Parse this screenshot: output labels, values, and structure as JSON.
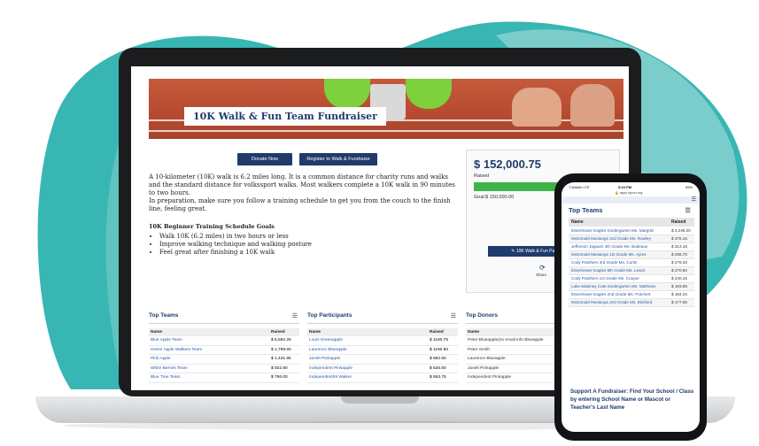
{
  "colors": {
    "teal": "#38b6b4",
    "teal_light": "#a6dcd8",
    "navy": "#1f3b6b",
    "green": "#3eb34a",
    "link": "#2a5aa8"
  },
  "hero": {
    "title": "10K Walk & Fun Team Fundraiser"
  },
  "actions": {
    "donate": "Donate Now",
    "register": "Register to Walk & Fundraise"
  },
  "description": {
    "p1": "A 10-kilometer (10K) walk is 6.2 miles long. It is a common distance for charity runs and walks and the standard distance for volkssport walks. Most walkers complete a 10K walk in 90 minutes to two hours.",
    "p2": "In preparation, make sure you follow a training schedule to get you from the couch to the finish line, feeling great."
  },
  "goals": {
    "heading": "10K Beginner Training Schedule Goals",
    "items": [
      "Walk 10K (6.2 miles) in two hours or less",
      "Improve walking technique and walking posture",
      "Feel great after finishing a 10K walk"
    ]
  },
  "raised": {
    "amount": "$ 152,000.75",
    "label": "Raised",
    "goal": "Goal:$ 150,000.00",
    "progress_fraction": 1.0,
    "participant_button": "10K Walk & Fun Participant C",
    "share_label": "Share"
  },
  "top_teams": {
    "title": "Top Teams",
    "headers": [
      "Name",
      "Raised"
    ],
    "rows": [
      [
        "Blue Apple Team",
        "$ 5,592.25"
      ],
      [
        "Green Apple Walkers Team",
        "$ 1,799.60"
      ],
      [
        "Pink Apple",
        "$ 1,431.85"
      ],
      [
        "White Berries Team",
        "$ 922.80"
      ],
      [
        "Blue Tree Team",
        "$ 756.00"
      ]
    ]
  },
  "top_participants": {
    "title": "Top Participants",
    "headers": [
      "Name",
      "Raised"
    ],
    "rows": [
      [
        "Louis Greenapple",
        "$ 1160.75"
      ],
      [
        "Laurence Blueapple",
        "$ 1160.50"
      ],
      [
        "Janelt Pinkapple",
        "$ 682.50"
      ],
      [
        "Independent Pinkapple",
        "$ 626.60"
      ],
      [
        "Independent59 Walker",
        "$ 563.75"
      ]
    ]
  },
  "top_donors": {
    "title": "Top Donors",
    "headers": [
      "Name"
    ],
    "rows": [
      [
        "Peter Blueapple(no email info Blueapple"
      ],
      [
        "Peter Smith"
      ],
      [
        "Laurence Blueapple"
      ],
      [
        "Janelt Pinkapple"
      ],
      [
        "Independent Pinkapple"
      ]
    ]
  },
  "phone": {
    "status_left": "T-Mobile LTE",
    "time": "5:23 PM",
    "battery": "55%",
    "url": "apps.rsport.org",
    "title": "Top Teams",
    "headers": [
      "Name",
      "Raised"
    ],
    "rows": [
      [
        "Eisenhower Eagles Kindergarten Ms. Margritz",
        "$ 2,249.20"
      ],
      [
        "McDonald Mustangs 2nd Grade Ms. Rowley",
        "$ 375.16"
      ],
      [
        "Jefferson Jaguars 4th Grade Ms. Bodeaux",
        "$ 313.18"
      ],
      [
        "McDonald Mustangs 1st Grade Ms. Ayres",
        "$ 295.70"
      ],
      [
        "Cody Panthers 3rd Grade Ms. Curtis",
        "$ 276.33"
      ],
      [
        "Eisenhower Eagles 5th Grade Ms. Leach",
        "$ 270.60"
      ],
      [
        "Cody Panthers 1st Grade Ms. Cooper",
        "$ 240.15"
      ],
      [
        "Lake Maloney Cats Kindergarten Ms. Mathews",
        "$ 193.55"
      ],
      [
        "Eisenhower Eagles 2nd Grade Ms. Potchert",
        "$ 184.23"
      ],
      [
        "McDonald Mustangs 2nd Grade Ms. Bickford",
        "$ 177.65"
      ]
    ],
    "footer": "Support A Fundraiser: Find Your School / Class by entering School Name or Mascot or Teacher's Last Name"
  }
}
